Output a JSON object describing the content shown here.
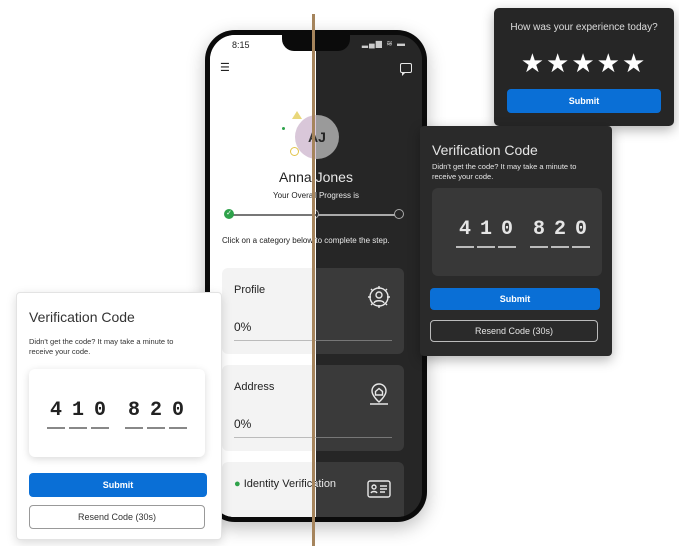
{
  "phone": {
    "status_time": "8:15",
    "status_icons": "▂▄▆ ≋ ▬",
    "avatar_initials": "AJ",
    "user_name": "Anna Jones",
    "progress_label": "Your Overall Progress is",
    "hint": "Click on a category below to complete the step.",
    "cards": [
      {
        "title": "Profile",
        "percent": "0%",
        "icon": "gear-user-icon"
      },
      {
        "title": "Address",
        "percent": "0%",
        "icon": "home-location-icon"
      },
      {
        "title": "Identity Verification",
        "icon": "id-card-icon",
        "status": "complete"
      }
    ],
    "steps": {
      "completed": 1,
      "total": 3
    }
  },
  "rating": {
    "question": "How was your experience today?",
    "stars": "★★★★★",
    "rating_value": 5,
    "submit_label": "Submit"
  },
  "verification_dark": {
    "title": "Verification Code",
    "description": "Didn't get the code? It may take a minute to receive your code.",
    "digits": [
      "4",
      "1",
      "0",
      "8",
      "2",
      "0"
    ],
    "submit_label": "Submit",
    "resend_label": "Resend Code (30s)"
  },
  "verification_light": {
    "title": "Verification Code",
    "description": "Didn't get the code? It may take a minute to receive your code.",
    "digits": [
      "4",
      "1",
      "0",
      "8",
      "2",
      "0"
    ],
    "submit_label": "Submit",
    "resend_label": "Resend Code (30s)"
  },
  "colors": {
    "accent_blue": "#0a6fd6",
    "success_green": "#2ea24a",
    "dark_surface": "#262626",
    "divider": "#a5845c"
  }
}
